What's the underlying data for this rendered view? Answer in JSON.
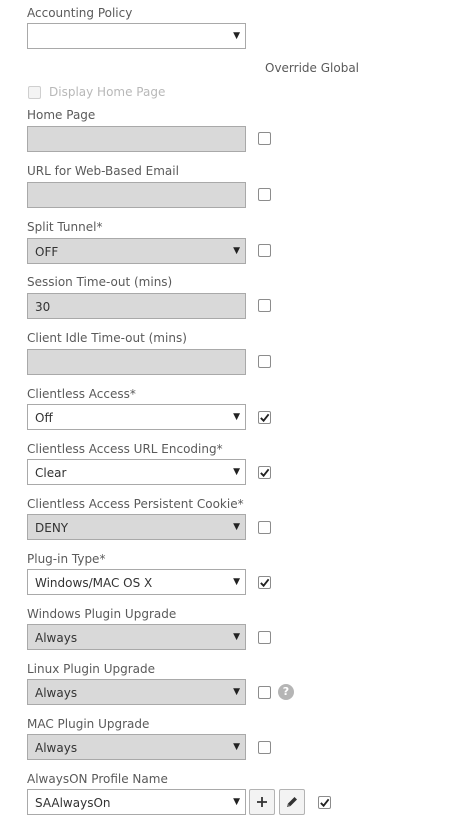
{
  "accounting_policy": {
    "label": "Accounting Policy",
    "value": ""
  },
  "override_global_label": "Override Global",
  "display_home_page": {
    "label": "Display Home Page",
    "checked": false
  },
  "home_page": {
    "label": "Home Page",
    "value": "",
    "override": false
  },
  "web_email": {
    "label": "URL for Web-Based Email",
    "value": "",
    "override": false
  },
  "split_tunnel": {
    "label": "Split Tunnel*",
    "value": "OFF",
    "override": false
  },
  "session_timeout": {
    "label": "Session Time-out (mins)",
    "value": "30",
    "override": false
  },
  "client_idle_timeout": {
    "label": "Client Idle Time-out (mins)",
    "value": "",
    "override": false
  },
  "clientless_access": {
    "label": "Clientless Access*",
    "value": "Off",
    "override": true
  },
  "clientless_url_encoding": {
    "label": "Clientless Access URL Encoding*",
    "value": "Clear",
    "override": true
  },
  "clientless_persistent_cookie": {
    "label": "Clientless Access Persistent Cookie*",
    "value": "DENY",
    "override": false
  },
  "plugin_type": {
    "label": "Plug-in Type*",
    "value": "Windows/MAC OS X",
    "override": true
  },
  "windows_plugin_upgrade": {
    "label": "Windows Plugin Upgrade",
    "value": "Always",
    "override": false
  },
  "linux_plugin_upgrade": {
    "label": "Linux Plugin Upgrade",
    "value": "Always",
    "override": false
  },
  "mac_plugin_upgrade": {
    "label": "MAC Plugin Upgrade",
    "value": "Always",
    "override": false
  },
  "alwayson_profile": {
    "label": "AlwaysON Profile Name",
    "value": "SAAlwaysOn",
    "override": true
  },
  "icons": {
    "dropdown": "chevron-down-icon",
    "check": "checkmark-icon",
    "help": "help-icon",
    "add": "plus-icon",
    "edit": "pencil-icon"
  }
}
